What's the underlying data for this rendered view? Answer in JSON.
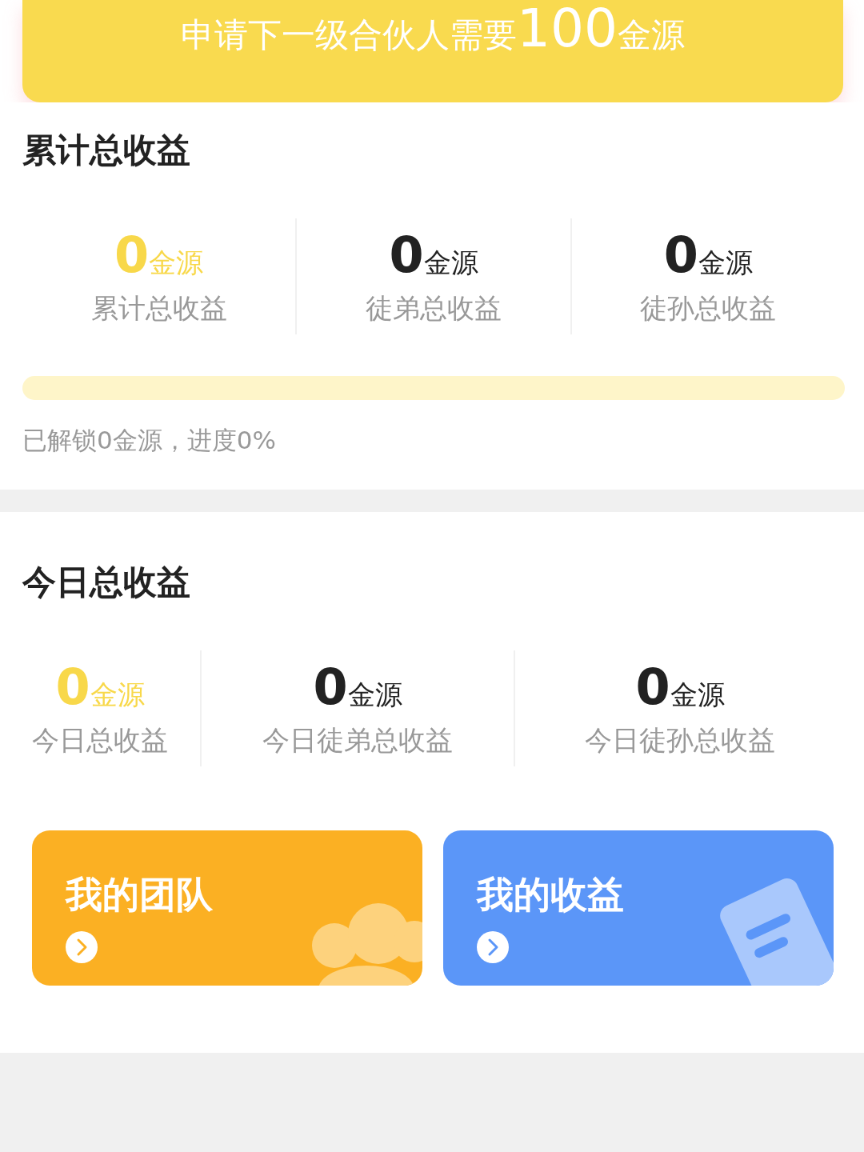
{
  "banner": {
    "text_before": "申请下一级合伙人需要",
    "amount": "100",
    "unit": "金源"
  },
  "total": {
    "title": "累计总收益",
    "stats": [
      {
        "value": "0",
        "unit": "金源",
        "label": "累计总收益",
        "highlight": true
      },
      {
        "value": "0",
        "unit": "金源",
        "label": "徒弟总收益",
        "highlight": false
      },
      {
        "value": "0",
        "unit": "金源",
        "label": "徒孙总收益",
        "highlight": false
      }
    ],
    "progress": {
      "level": 0
    },
    "progress_text": "已解锁0金源，进度0%"
  },
  "today": {
    "title": "今日总收益",
    "stats": [
      {
        "value": "0",
        "unit": "金源",
        "label": "今日总收益",
        "highlight": true
      },
      {
        "value": "0",
        "unit": "金源",
        "label": "今日徒弟总收益",
        "highlight": false
      },
      {
        "value": "0",
        "unit": "金源",
        "label": "今日徒孙总收益",
        "highlight": false
      }
    ]
  },
  "cards": [
    {
      "kind": "team",
      "title": "我的团队"
    },
    {
      "kind": "income",
      "title": "我的收益"
    }
  ]
}
